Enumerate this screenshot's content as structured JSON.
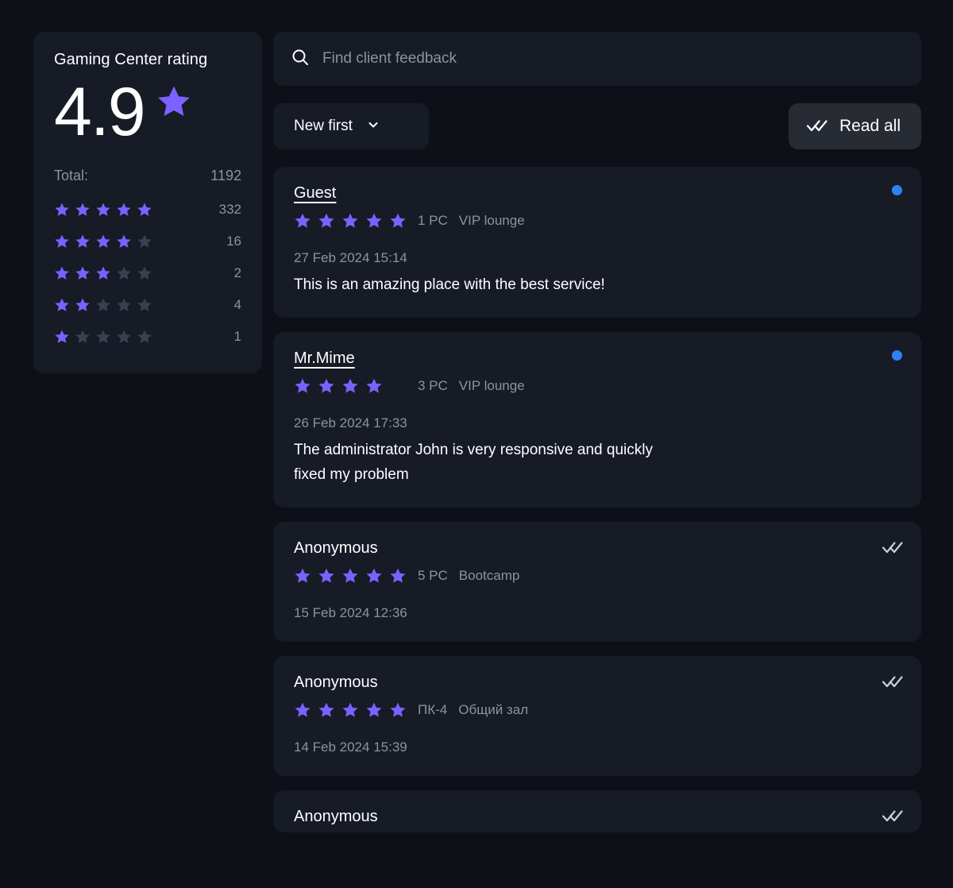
{
  "rating_panel": {
    "title": "Gaming Center rating",
    "score": "4.9",
    "score_star_icon": "star-icon",
    "total_label": "Total:",
    "total_value": "1192",
    "breakdown": [
      {
        "stars": 5,
        "count": "332"
      },
      {
        "stars": 4,
        "count": "16"
      },
      {
        "stars": 3,
        "count": "2"
      },
      {
        "stars": 2,
        "count": "4"
      },
      {
        "stars": 1,
        "count": "1"
      }
    ]
  },
  "search": {
    "placeholder": "Find client feedback",
    "value": "",
    "icon": "search-icon"
  },
  "controls": {
    "sort": {
      "selected": "New first",
      "chevron_icon": "chevron-down-icon"
    },
    "read_all": {
      "label": "Read all",
      "icon": "double-check-icon"
    }
  },
  "reviews": [
    {
      "name": "Guest",
      "name_is_link": true,
      "rating": 5,
      "show_empty_stars": false,
      "pc": "1 PC",
      "zone": "VIP lounge",
      "date": "27 Feb 2024 15:14",
      "text": "This is an amazing place with the best service!",
      "status": "unread",
      "status_icon": "unread-dot-icon"
    },
    {
      "name": "Mr.Mime",
      "name_is_link": true,
      "rating": 4,
      "show_empty_stars": false,
      "pc": "3 PC",
      "zone": "VIP lounge",
      "date": "26 Feb 2024 17:33",
      "text": "The administrator John is very responsive and quickly fixed my problem",
      "status": "unread",
      "status_icon": "unread-dot-icon"
    },
    {
      "name": "Anonymous",
      "name_is_link": false,
      "rating": 5,
      "show_empty_stars": false,
      "pc": "5 PC",
      "zone": "Bootcamp",
      "date": "15 Feb 2024 12:36",
      "text": "",
      "status": "read",
      "status_icon": "double-check-icon"
    },
    {
      "name": "Anonymous",
      "name_is_link": false,
      "rating": 5,
      "show_empty_stars": false,
      "pc": "ПК-4",
      "zone": "Общий зал",
      "date": "14 Feb 2024 15:39",
      "text": "",
      "status": "read",
      "status_icon": "double-check-icon"
    },
    {
      "name": "Anonymous",
      "name_is_link": false,
      "rating": 0,
      "show_empty_stars": false,
      "pc": "",
      "zone": "",
      "date": "",
      "text": "",
      "status": "read",
      "status_icon": "double-check-icon",
      "truncated": true
    }
  ],
  "colors": {
    "page_background": "#0d1117",
    "card_background": "#161b26",
    "star_filled": "#7b61ff",
    "star_empty": "#3a4050",
    "unread_dot": "#2f80f5",
    "text_primary": "#ffffff",
    "text_muted": "#8b949e",
    "button_background": "#272b33"
  }
}
